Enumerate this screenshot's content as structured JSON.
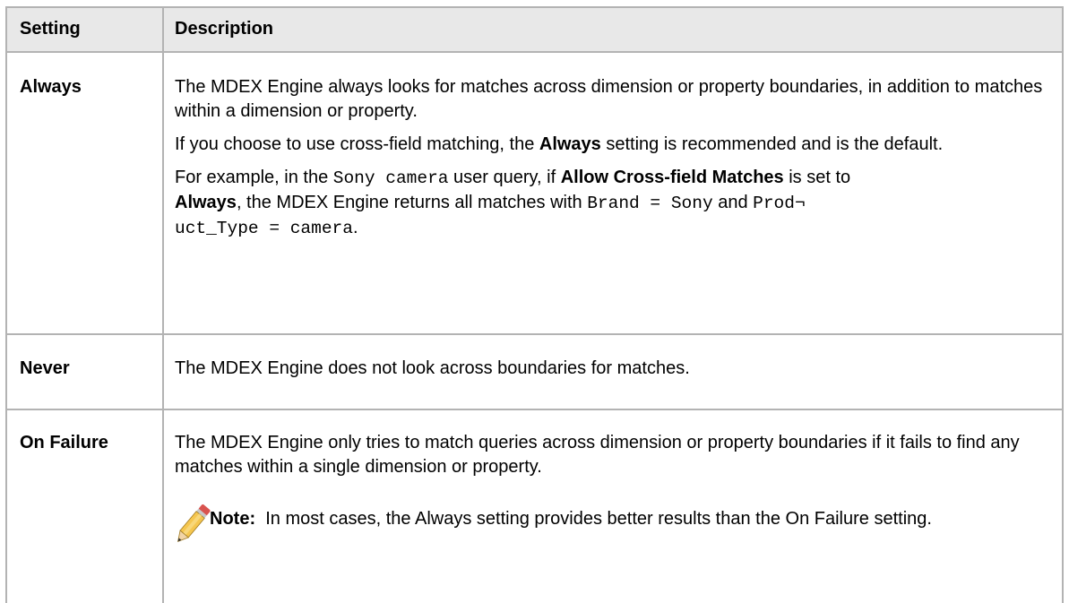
{
  "header": {
    "setting": "Setting",
    "description": "Description"
  },
  "rows": [
    {
      "setting": "Always",
      "p1": "The MDEX Engine always looks for matches across dimension or property boundaries, in addition to matches within a dimension or property.",
      "p2a": "If you choose to use cross-field matching, the ",
      "p2b": "Always",
      "p2c": " setting is recommended and is the default.",
      "p3a": "For example, in the ",
      "p3code1": "Sony camera",
      "p3b": " user query, if ",
      "p3c": "Allow Cross-field Matches",
      "p3d": " is set to",
      "p3e": "Always",
      "p3f": ", the MDEX Engine returns all matches with ",
      "p3code2": "Brand = Sony",
      "p3g": " and ",
      "p3code3": "Prod¬",
      "p3code4": "uct_Type = camera",
      "p3h": "."
    },
    {
      "setting": "Never",
      "p1": "The MDEX Engine does not look across boundaries for matches."
    },
    {
      "setting": "On Failure",
      "p1": "The MDEX Engine only tries to match queries across dimension or property boundaries if it fails to find any matches within a single dimension or property.",
      "note_label": "Note:",
      "note_text": "In most cases, the Always setting provides better results than the On Failure setting.",
      "note_icon": "pencil-icon"
    }
  ]
}
